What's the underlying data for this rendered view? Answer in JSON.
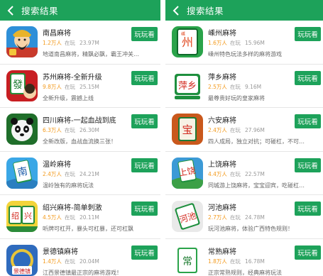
{
  "colors": {
    "brand": "#1da25a",
    "download": "#f39a1c"
  },
  "left": {
    "title": "搜索结果",
    "play_label": "玩玩看",
    "online_label": "在玩",
    "items": [
      {
        "name": "南昌麻将",
        "downloads": "1.2万人",
        "size": "23.97M",
        "desc": "地道南昌麻将，精飘必飘，霸王冲关…",
        "icon": "god-of-wealth-icon"
      },
      {
        "name": "苏州麻将-全新升级",
        "downloads": "9.8万人",
        "size": "25.15M",
        "desc": "全新升级，震撼上线",
        "icon": "mahjong-tile-icon"
      },
      {
        "name": "四川麻将-一起血战到底",
        "downloads": "6.3万人",
        "size": "26.30M",
        "desc": "全新改版，血战血流换三张！",
        "icon": "panda-icon"
      },
      {
        "name": "温岭麻将",
        "downloads": "2.4万人",
        "size": "24.21M",
        "desc": "温岭独有的麻将玩法",
        "icon": "nan-tile-icon"
      },
      {
        "name": "绍兴麻将-简单刺激",
        "downloads": "4.5万人",
        "size": "20.11M",
        "desc": "听牌可杠开，暴头可杠暴，还可杠飘",
        "icon": "shaoxing-tile-icon"
      },
      {
        "name": "景德镇麻将",
        "downloads": "1.4万人",
        "size": "20.04M",
        "desc": "江西景德镇最正宗的麻将游戏！",
        "icon": "jingdezhen-icon"
      }
    ]
  },
  "right": {
    "title": "搜索结果",
    "play_label": "玩玩看",
    "online_label": "在玩",
    "items": [
      {
        "name": "嵊州麻将",
        "downloads": "1.6万人",
        "size": "15.96M",
        "desc": "嵊州特色玩法多样的麻将游戏",
        "icon": "shengzhou-tile-icon"
      },
      {
        "name": "萍乡麻将",
        "downloads": "2.5万人",
        "size": "9.16M",
        "desc": "最尊贵好玩的皇家麻将",
        "icon": "pingxiang-tile-icon"
      },
      {
        "name": "六安麻将",
        "downloads": "2.4万人",
        "size": "27.96M",
        "desc": "四人成局，独立对抗；可碰杠，不可…",
        "icon": "bao-tile-icon"
      },
      {
        "name": "上饶麻将",
        "downloads": "4.4万人",
        "size": "22.57M",
        "desc": "同城游上饶麻将，宝宝迎宾，吃碰杠…",
        "icon": "shangrao-tile-icon"
      },
      {
        "name": "河池麻将",
        "downloads": "2.7万人",
        "size": "24.78M",
        "desc": "玩河池麻将，体验广西特色规则！",
        "icon": "hechi-tile-icon"
      },
      {
        "name": "常熟麻将",
        "downloads": "1.8万人",
        "size": "16.78M",
        "desc": "正宗常熟规则，经典麻将玩法",
        "icon": "changshu-tile-icon"
      }
    ]
  }
}
